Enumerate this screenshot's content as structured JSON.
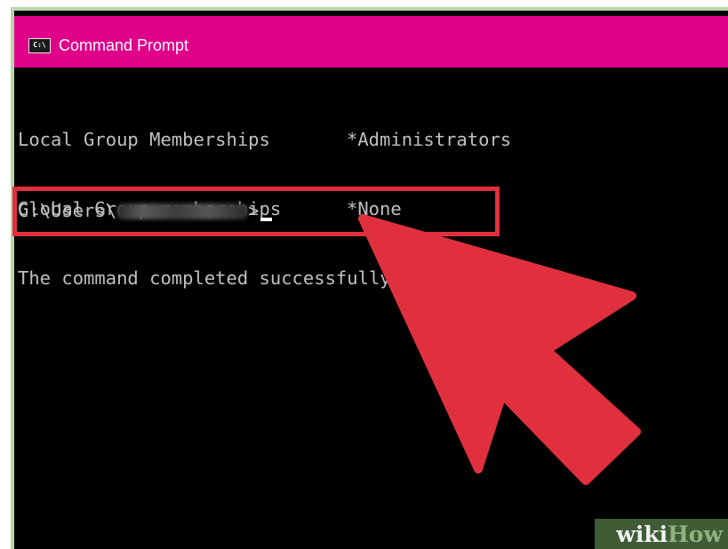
{
  "window": {
    "title": "Command Prompt",
    "icon": "cmd-app-icon",
    "icon_text": "C:\\",
    "titlebar_color": "#e0008a"
  },
  "console": {
    "lines": [
      {
        "label": "Local Group Memberships",
        "value": "*Administrators"
      },
      {
        "label": "Global Group memberships",
        "value": "*None"
      },
      {
        "label": "The command completed successfully.",
        "value": ""
      }
    ],
    "prompt_prefix": "C:\\Users\\",
    "prompt_suffix": ">",
    "text_color": "#c0c0c0",
    "background": "#000000"
  },
  "annotation": {
    "highlight_color": "#e0303e",
    "arrow_icon": "pointer-arrow-icon"
  },
  "watermark": {
    "part1": "wiki",
    "part2": "How"
  }
}
